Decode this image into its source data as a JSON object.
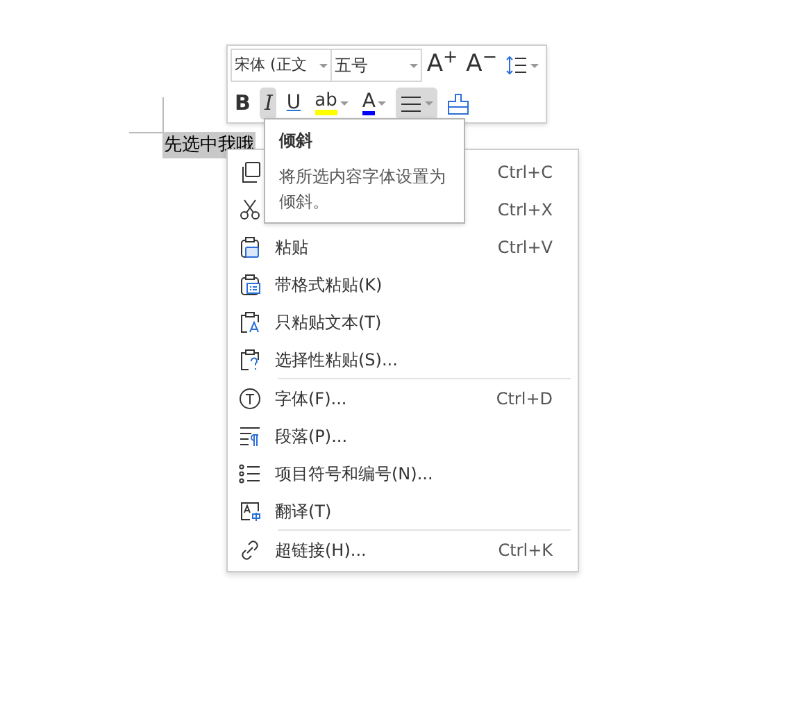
{
  "document": {
    "text": "先选中我哦",
    "selected": true
  },
  "toolbar": {
    "font_name": "宋体 (正文",
    "font_size": "五号",
    "row_1": [
      {
        "kind": "grow",
        "text": "A$^{+}$",
        "selected": false,
        "dropdown": false
      },
      {
        "kind": "shrink",
        "text": "A$^{−}$",
        "selected": false,
        "dropdown": false
      },
      {
        "kind": "spacing",
        "selected": false,
        "dropdown": true
      }
    ],
    "row_2": [
      {
        "kind": "bold",
        "text": "B",
        "selected": false,
        "dropdown": false
      },
      {
        "kind": "italic",
        "text": "I",
        "selected": true,
        "dropdown": false
      },
      {
        "kind": "underline",
        "text": "U",
        "selected": false,
        "dropdown": false
      },
      {
        "kind": "highlight",
        "text": "ab",
        "selected": false,
        "dropdown": true,
        "color": "#ffff00"
      },
      {
        "kind": "fontcolor",
        "text": "A",
        "selected": false,
        "dropdown": true,
        "color": "#0000ff"
      },
      {
        "kind": "align",
        "selected": true,
        "dropdown": true
      },
      {
        "kind": "painter",
        "selected": false,
        "dropdown": false
      }
    ]
  },
  "tooltip": {
    "title": "倾斜",
    "body": "将所选内容字体设置为倾斜。"
  },
  "menu": [
    {
      "kind": "copy",
      "shortcut": "Ctrl+C",
      "separator_after": false
    },
    {
      "kind": "cut",
      "shortcut": "Ctrl+X",
      "separator_after": false
    },
    {
      "kind": "paste",
      "label": "粘贴",
      "shortcut": "Ctrl+V",
      "separator_after": false
    },
    {
      "kind": "paste-format",
      "label": "带格式粘贴(K)",
      "separator_after": false
    },
    {
      "kind": "paste-text",
      "label": "只粘贴文本(T)",
      "separator_after": false
    },
    {
      "kind": "paste-special",
      "label": "选择性粘贴(S)...",
      "separator_after": true
    },
    {
      "kind": "font",
      "label": "字体(F)...",
      "shortcut": "Ctrl+D",
      "separator_after": false
    },
    {
      "kind": "paragraph",
      "label": "段落(P)...",
      "separator_after": false
    },
    {
      "kind": "bullets",
      "label": "项目符号和编号(N)...",
      "separator_after": false
    },
    {
      "kind": "translate",
      "label": "翻译(T)",
      "separator_after": true
    },
    {
      "kind": "link",
      "label": "超链接(H)...",
      "shortcut": "Ctrl+K",
      "separator_after": false
    }
  ]
}
